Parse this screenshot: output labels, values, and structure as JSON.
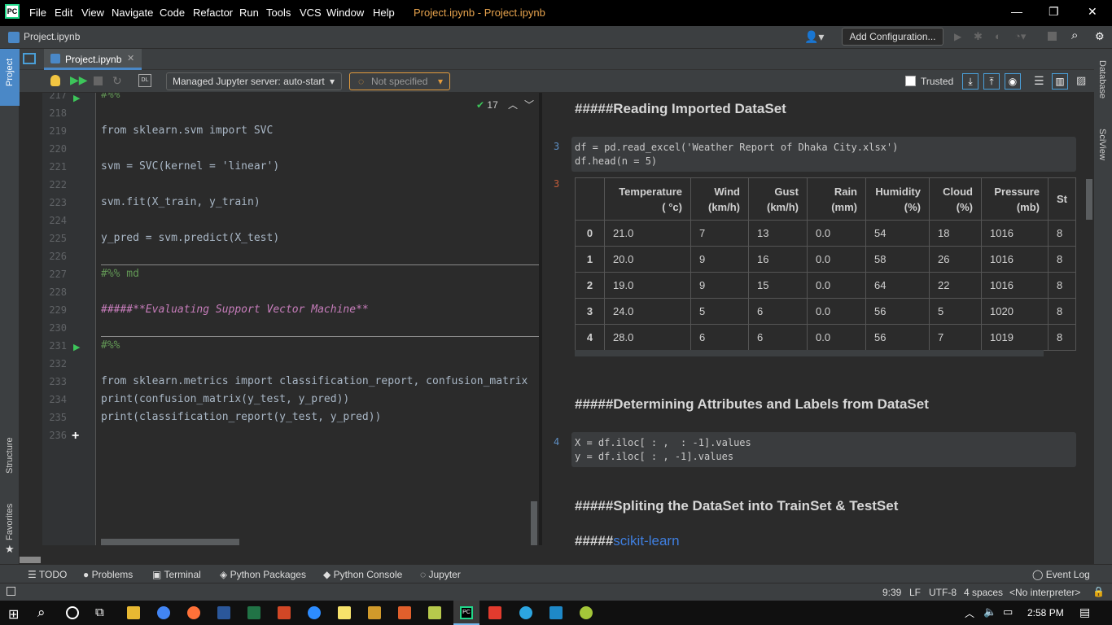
{
  "window": {
    "title": "Project.ipynb - Project.ipynb",
    "logo": "PC"
  },
  "menu": [
    "File",
    "Edit",
    "View",
    "Navigate",
    "Code",
    "Refactor",
    "Run",
    "Tools",
    "VCS",
    "Window",
    "Help"
  ],
  "nav": {
    "breadcrumb": "Project.ipynb",
    "add_config": "Add Configuration..."
  },
  "left_tabs": {
    "project": "Project",
    "structure": "Structure",
    "favorites": "Favorites"
  },
  "right_tabs": {
    "database": "Database",
    "sciview": "SciView"
  },
  "tab": {
    "label": "Project.ipynb"
  },
  "toolbar": {
    "server": "Managed Jupyter server: auto-start",
    "kernel": "Not specified",
    "trusted": "Trusted"
  },
  "editor": {
    "warnings": "17",
    "lines": [
      {
        "n": "217",
        "text": "#%%",
        "cls": "cmt"
      },
      {
        "n": "218",
        "text": ""
      },
      {
        "n": "219",
        "text": "from sklearn.svm import SVC"
      },
      {
        "n": "220",
        "text": ""
      },
      {
        "n": "221",
        "text": "svm = SVC(kernel = 'linear')"
      },
      {
        "n": "222",
        "text": ""
      },
      {
        "n": "223",
        "text": "svm.fit(X_train, y_train)"
      },
      {
        "n": "224",
        "text": ""
      },
      {
        "n": "225",
        "text": "y_pred = svm.predict(X_test)"
      },
      {
        "n": "226",
        "text": ""
      },
      {
        "n": "227",
        "text": "#%% md",
        "cls": "cmt"
      },
      {
        "n": "228",
        "text": ""
      },
      {
        "n": "229",
        "text": "#####**Evaluating Support Vector Machine**",
        "cls": "md"
      },
      {
        "n": "230",
        "text": ""
      },
      {
        "n": "231",
        "text": "#%%",
        "cls": "cmt"
      },
      {
        "n": "232",
        "text": ""
      },
      {
        "n": "233",
        "text": "from sklearn.metrics import classification_report, confusion_matrix"
      },
      {
        "n": "234",
        "text": "print(confusion_matrix(y_test, y_pred))"
      },
      {
        "n": "235",
        "text": "print(classification_report(y_test, y_pred))"
      },
      {
        "n": "236",
        "text": ""
      }
    ]
  },
  "preview": {
    "h1": "#####Reading Imported DataSet",
    "cell3_no": "3",
    "cell3": "df = pd.read_excel('Weather Report of Dhaka City.xlsx')\ndf.head(n = 5)",
    "out3_no": "3",
    "table": {
      "headers": [
        "",
        "Temperature ( °c)",
        "Wind (km/h)",
        "Gust (km/h)",
        "Rain (mm)",
        "Humidity (%)",
        "Cloud (%)",
        "Pressure (mb)",
        "St"
      ],
      "rows": [
        [
          "0",
          "21.0",
          "7",
          "13",
          "0.0",
          "54",
          "18",
          "1016",
          "8"
        ],
        [
          "1",
          "20.0",
          "9",
          "16",
          "0.0",
          "58",
          "26",
          "1016",
          "8"
        ],
        [
          "2",
          "19.0",
          "9",
          "15",
          "0.0",
          "64",
          "22",
          "1016",
          "8"
        ],
        [
          "3",
          "24.0",
          "5",
          "6",
          "0.0",
          "56",
          "5",
          "1020",
          "8"
        ],
        [
          "4",
          "28.0",
          "6",
          "6",
          "0.0",
          "56",
          "7",
          "1019",
          "8"
        ]
      ]
    },
    "h2": "#####Determining Attributes and Labels from DataSet",
    "cell4_no": "4",
    "cell4": "X = df.iloc[ : ,  : -1].values\ny = df.iloc[ : , -1].values",
    "h3": "#####Spliting the DataSet into TrainSet & TestSet",
    "h4_prefix": "#####",
    "h4_link": "scikit-learn"
  },
  "bottom_tabs": [
    "TODO",
    "Problems",
    "Terminal",
    "Python Packages",
    "Python Console",
    "Jupyter"
  ],
  "event_log": "Event Log",
  "status": {
    "pos": "9:39",
    "lf": "LF",
    "enc": "UTF-8",
    "indent": "4 spaces",
    "interp": "<No interpreter>"
  },
  "taskbar": {
    "time": "2:58 PM"
  }
}
